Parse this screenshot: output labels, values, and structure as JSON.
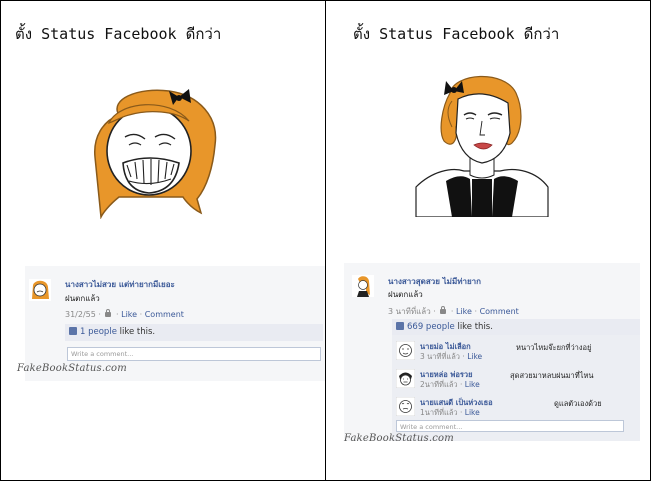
{
  "left_panel": {
    "title": "ตั้ง Status Facebook ดีกว่า",
    "post": {
      "name": "นางสาวไม่สวย แต่ท่ายากมีเยอะ",
      "status": "ฝนตกแล้ว",
      "date": "31/2/55",
      "like_label": "Like",
      "comment_label": "Comment",
      "likes_count": "1 people",
      "likes_suffix": "like this.",
      "comment_placeholder": "Write a comment..."
    },
    "watermark": "FakeBookStatus.com"
  },
  "right_panel": {
    "title": "ตั้ง Status Facebook ดีกว่า",
    "post": {
      "name": "นางสาวสุดสวย ไม่มีท่ายาก",
      "status": "ฝนตกแล้ว",
      "date": "3 นาทีที่แล้ว",
      "like_label": "Like",
      "comment_label": "Comment",
      "likes_count": "669 people",
      "likes_suffix": "like this.",
      "comments": [
        {
          "name": "นายม่อ ไม่เลือก",
          "time": "3 นาทีที่แล้ว",
          "like_label": "Like",
          "text": "หนาวไหมจ๊ะยกที่ว่างอยู่"
        },
        {
          "name": "นายหล่อ พ่อรวย",
          "time": "2นาทีที่แล้ว",
          "like_label": "Like",
          "text": "สุดสวยมาหลบฝนมาที่ไหน"
        },
        {
          "name": "นายแสนดี เป็นห่วงเธอ",
          "time": "1นาทีที่แล้ว",
          "like_label": "Like",
          "text": "ดูแลตัวเองด้วย"
        }
      ],
      "comment_placeholder": "Write a comment..."
    },
    "watermark": "FakeBookStatus.com"
  },
  "icons": {
    "privacy": "lock-icon",
    "like": "thumbs-up-icon"
  },
  "colors": {
    "link": "#3b5998",
    "hair": "#e8962a",
    "likes_bg": "#e9ebf2"
  }
}
